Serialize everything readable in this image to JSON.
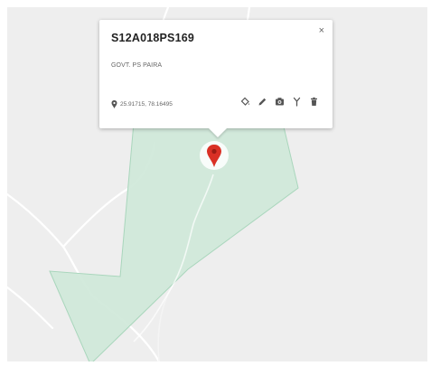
{
  "map": {
    "region_fill": "#cfe8d9",
    "region_stroke": "#a9d6bc",
    "road_color": "#ffffff",
    "background_color": "#eeeeee"
  },
  "popup": {
    "title": "S12A018PS169",
    "subtitle": "GOVT. PS PAIRA",
    "coordinates": "25.91715, 78.16495",
    "close_glyph": "×",
    "actions": [
      {
        "name": "paint-bucket-icon"
      },
      {
        "name": "pencil-icon"
      },
      {
        "name": "camera-icon"
      },
      {
        "name": "fork-icon"
      },
      {
        "name": "trash-icon"
      }
    ]
  },
  "marker": {
    "color": "#d93025",
    "ring_color": "#ffffff"
  }
}
